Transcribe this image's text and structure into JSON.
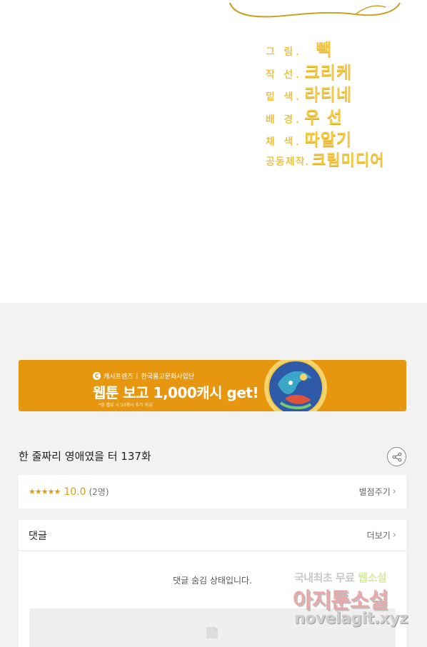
{
  "credits": [
    {
      "role": "그 림.",
      "name": "빽"
    },
    {
      "role": "작 선.",
      "name": "크리케"
    },
    {
      "role": "밑 색.",
      "name": "라티네"
    },
    {
      "role": "배 경.",
      "name": "우 선"
    },
    {
      "role": "채 색.",
      "name": "따알기"
    },
    {
      "role": "공동제작.",
      "name": "크림미디어"
    }
  ],
  "banner": {
    "brand": "캐시프렌즈",
    "partner": "한국물고문화사업단",
    "headline": "웹툰 보고 1,000캐시 get!",
    "fine_print": "*앱 웹뷰 시 50캐시 추가 지급",
    "colors": {
      "background": "#e6960f"
    }
  },
  "episode": {
    "title": "한 줄짜리 영애였을 터 137화"
  },
  "rating": {
    "stars": "★★★★★",
    "score": "10.0",
    "count": "(2명)",
    "rate_label": "별점주기"
  },
  "comments": {
    "title": "댓글",
    "more_label": "더보기",
    "hidden_message": "댓글 숨김 상태입니다."
  },
  "watermark": {
    "line1_a": "국내최초 무료",
    "line1_b": "웹소설",
    "line2": "아지툰소설",
    "line3": "novelagit.xyz"
  },
  "icons": {
    "share": "share-icon",
    "chevron": "chevron-right-icon",
    "placeholder": "image-placeholder-icon"
  }
}
